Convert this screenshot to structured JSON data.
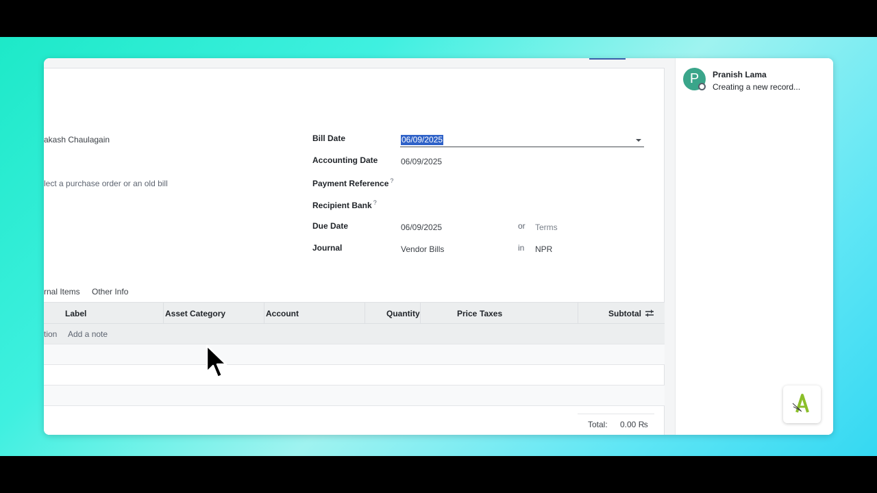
{
  "user": {
    "initial": "P",
    "name": "Pranish Lama",
    "status": "Creating a new record..."
  },
  "left_fields": {
    "vendor_value": "akash Chaulagain",
    "autocomplete_placeholder": "lect a purchase order or an old bill"
  },
  "right_fields": {
    "bill_date_label": "Bill Date",
    "bill_date_value": "06/09/2025",
    "accounting_date_label": "Accounting Date",
    "accounting_date_value": "06/09/2025",
    "payment_reference_label": "Payment Reference",
    "recipient_bank_label": "Recipient Bank",
    "help_mark": "?",
    "due_date_label": "Due Date",
    "due_date_value": "06/09/2025",
    "or_text": "or",
    "terms_placeholder": "Terms",
    "journal_label": "Journal",
    "journal_value": "Vendor Bills",
    "in_text": "in",
    "currency_value": "NPR"
  },
  "tabs": [
    {
      "label": "rnal Items"
    },
    {
      "label": "Other Info"
    }
  ],
  "table": {
    "columns": [
      "Label",
      "Asset Category",
      "Account",
      "Quantity",
      "Price",
      "Taxes",
      "Subtotal"
    ],
    "add_section_partial": "tion",
    "add_note": "Add a note"
  },
  "totals": {
    "label": "Total:",
    "value": "0.00 ₨"
  },
  "colors": {
    "accent": "#2f62c8",
    "avatar": "#3aa58a",
    "bg_gradient_start": "#1de9c8",
    "bg_gradient_end": "#35d8f2"
  },
  "icons": {
    "optional_columns": "sliders-icon",
    "caret": "chevron-down-icon",
    "cursor": "mouse-pointer-icon",
    "app_widget": "brand-logo-icon"
  }
}
